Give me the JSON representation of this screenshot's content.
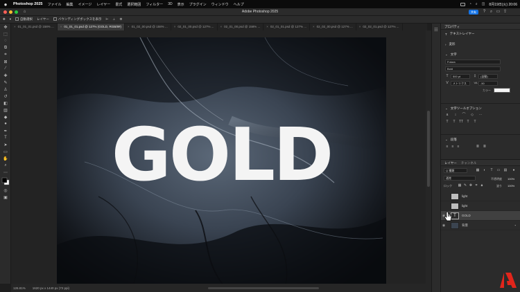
{
  "menubar": {
    "app_name": "Photoshop 2025",
    "items": [
      "ファイル",
      "編集",
      "イメージ",
      "レイヤー",
      "書式",
      "選択範囲",
      "フィルター",
      "3D",
      "表示",
      "プラグイン",
      "ウィンドウ",
      "ヘルプ"
    ],
    "datetime": "8月19日(火) 20:06"
  },
  "window": {
    "title": "Adobe Photoshop 2025",
    "share_label": "共有"
  },
  "options": {
    "auto_select": "自動選択",
    "target": "レイヤー",
    "bounding_box": "バウンディングボックスを表示"
  },
  "tabs": [
    {
      "label": "01_01_01.psd @ 158% ..."
    },
    {
      "label": "01_01_01.psd @ 127% (GOLD, RGB/8#)",
      "active": true
    },
    {
      "label": "01_02_00.psd @ 158% ..."
    },
    {
      "label": "02_01_00.psd @ 127% ..."
    },
    {
      "label": "02_01_00.psd @ 158% ..."
    },
    {
      "label": "02_01_01.psd @ 127% ..."
    },
    {
      "label": "02_02_00.psd @ 127% ..."
    },
    {
      "label": "02_02_01.psd @ 127% ..."
    }
  ],
  "canvas": {
    "text": "GOLD"
  },
  "status": {
    "zoom": "126.81%",
    "doc_size": "1620 px x 1440 px (72 ppi)"
  },
  "properties": {
    "title": "プロパティ",
    "layer_kind": "テキストレイヤー",
    "transform_label": "変形",
    "character_label": "文字",
    "font_family": "Futura",
    "font_style": "Bold",
    "font_size": "500 pt",
    "leading": "(自動)",
    "tracking_label": "VA",
    "tracking_value": "-50",
    "kerning": "メトリクス",
    "color_label": "カラー",
    "text_options": "文字ツールオプション",
    "paragraph_label": "段落"
  },
  "layers": {
    "tab_layers": "レイヤー",
    "tab_channels": "チャンネル",
    "filter_kind": "Q 種類",
    "blend_mode": "通常",
    "opacity_label": "不透明度",
    "opacity_value": "100%",
    "lock_label": "ロック",
    "fill_label": "塗り",
    "fill_value": "100%",
    "items": [
      {
        "name": "light"
      },
      {
        "name": "light"
      },
      {
        "name": "GOLD",
        "type": "text",
        "selected": true
      },
      {
        "name": "背景",
        "locked": true
      }
    ]
  },
  "colors": {
    "accent": "#1473e6",
    "adobe_red": "#e1251b"
  }
}
